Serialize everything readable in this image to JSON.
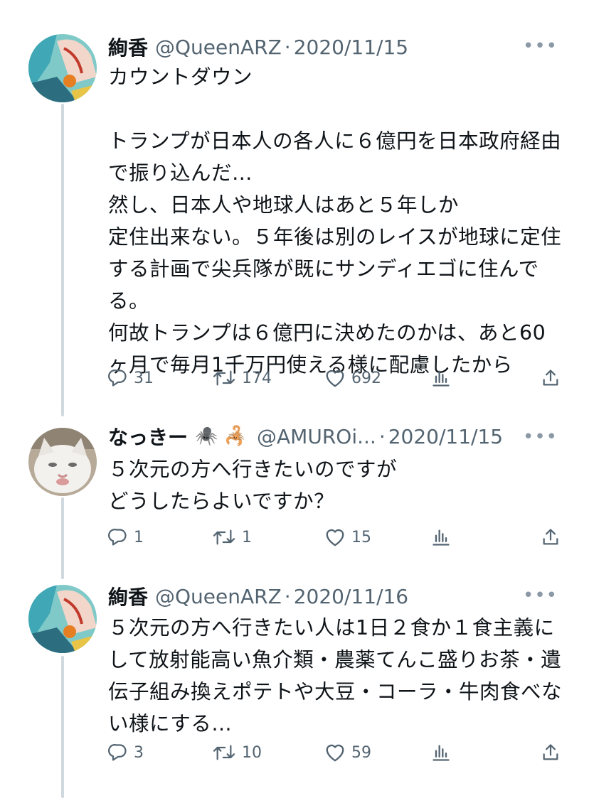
{
  "tweets": [
    {
      "name": "絢香",
      "handle": "@QueenARZ",
      "separator": "·",
      "date": "2020/11/15",
      "more": "•••",
      "text": "カウントダウン\n\nトランプが日本人の各人に６億円を日本政府経由で振り込んだ…\n然し、日本人や地球人はあと５年しか\n定住出来ない。５年後は別のレイスが地球に定住する計画で尖兵隊が既にサンディエゴに住んでる。\n何故トランプは６億円に決めたのかは、あと60ヶ月で毎月1千万円使える様に配慮したから",
      "replies": "31",
      "retweets": "174",
      "likes": "692"
    },
    {
      "name": "なっきー",
      "name_emojis": "🕷️ 🦂",
      "handle": "@AMUROi...",
      "separator": "·",
      "date": "2020/11/15",
      "more": "•••",
      "text": "５次元の方へ行きたいのですが\nどうしたらよいですか？",
      "replies": "1",
      "retweets": "1",
      "likes": "15"
    },
    {
      "name": "絢香",
      "handle": "@QueenARZ",
      "separator": "·",
      "date": "2020/11/16",
      "more": "•••",
      "text": "５次元の方へ行きたい人は1日２食か１食主義にして放射能高い魚介類・農薬てんこ盛りお茶・遺伝子組み換えポテトや大豆・コーラ・牛肉食べない様にする…",
      "replies": "3",
      "retweets": "10",
      "likes": "59"
    }
  ],
  "icons": [
    "reply-icon",
    "retweet-icon",
    "like-icon",
    "analytics-icon",
    "share-icon"
  ],
  "colors": {
    "text": "#0f1419",
    "secondary": "#536471",
    "thread_line": "#cfd9de"
  }
}
